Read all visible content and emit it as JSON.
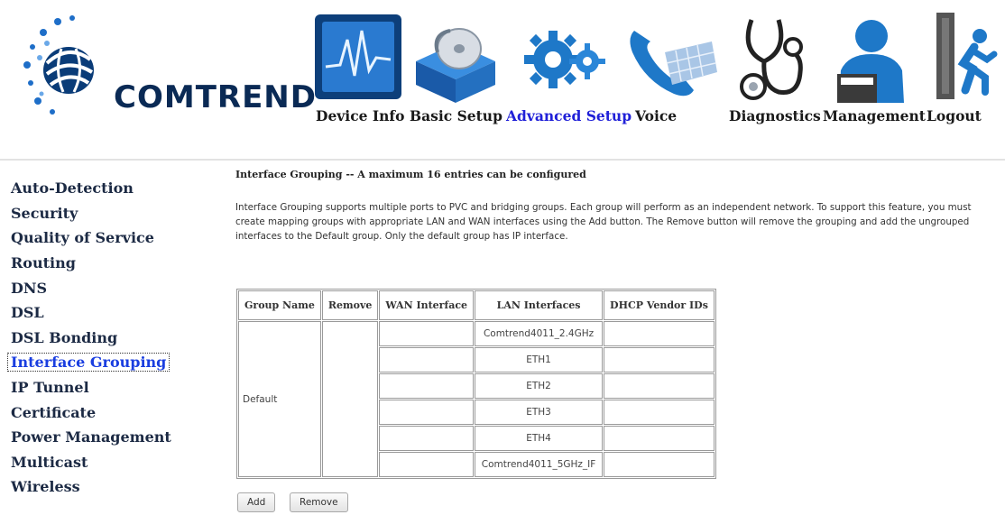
{
  "brand": {
    "name": "COMTREND"
  },
  "nav": [
    {
      "label": "Device Info",
      "icon": "waveform-monitor-icon"
    },
    {
      "label": "Basic Setup",
      "icon": "disc-box-icon"
    },
    {
      "label": "Advanced Setup",
      "icon": "gears-icon",
      "active": true
    },
    {
      "label": "Voice",
      "icon": "phone-icon"
    },
    {
      "label": "Diagnostics",
      "icon": "stethoscope-icon"
    },
    {
      "label": "Management",
      "icon": "user-computer-icon"
    },
    {
      "label": "Logout",
      "icon": "exit-door-icon"
    }
  ],
  "sidebar": [
    "Auto-Detection",
    "Security",
    "Quality of Service",
    "Routing",
    "DNS",
    "DSL",
    "DSL Bonding",
    "Interface Grouping",
    "IP Tunnel",
    "Certificate",
    "Power Management",
    "Multicast",
    "Wireless"
  ],
  "sidebar_active": "Interface Grouping",
  "page": {
    "title": "Interface Grouping -- A maximum 16 entries can be configured",
    "description": "Interface Grouping supports multiple ports to PVC and bridging groups. Each group will perform as an independent network. To support this feature, you must create mapping groups with appropriate LAN and WAN interfaces using the Add button. The Remove button will remove the grouping and add the ungrouped interfaces to the Default group. Only the default group has IP interface."
  },
  "table": {
    "headers": [
      "Group Name",
      "Remove",
      "WAN Interface",
      "LAN Interfaces",
      "DHCP Vendor IDs"
    ],
    "group_name": "Default",
    "lan_interfaces": [
      "Comtrend4011_2.4GHz",
      "ETH1",
      "ETH2",
      "ETH3",
      "ETH4",
      "Comtrend4011_5GHz_IF"
    ]
  },
  "buttons": {
    "add": "Add",
    "remove": "Remove"
  },
  "colors": {
    "active_nav": "#2020d8",
    "active_sidebar": "#1a3ee0",
    "brand_dark": "#0a2a55",
    "icon_blue": "#1e78c8"
  }
}
